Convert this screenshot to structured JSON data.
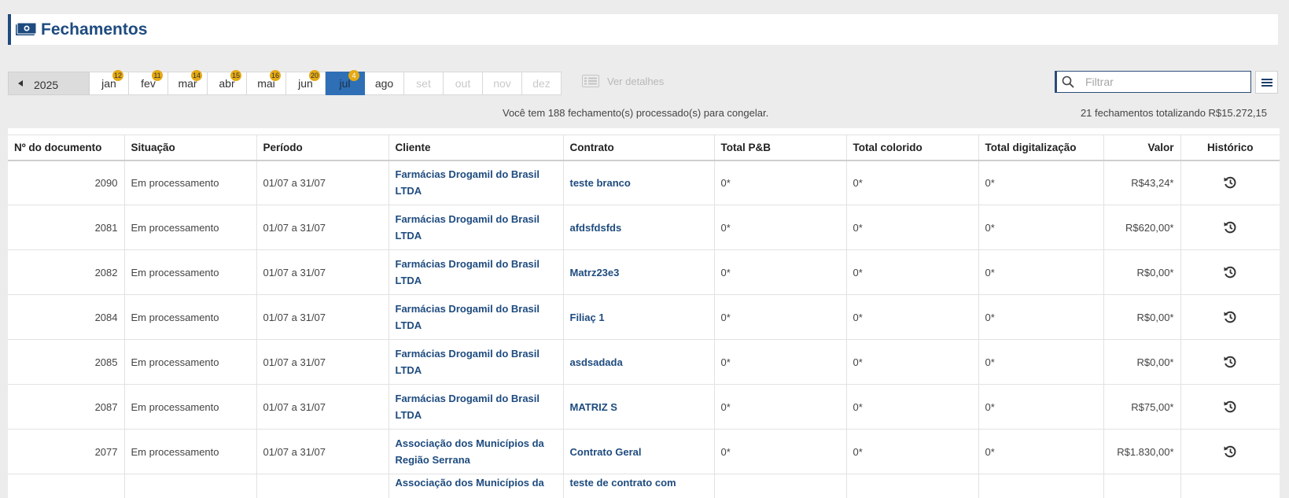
{
  "header": {
    "title": "Fechamentos",
    "icon": "money-icon",
    "accent": "#1e4b7f"
  },
  "calendar": {
    "year": "2025",
    "months": [
      {
        "label": "jan",
        "badge": "12",
        "state": "normal"
      },
      {
        "label": "fev",
        "badge": "11",
        "state": "normal"
      },
      {
        "label": "mar",
        "badge": "14",
        "state": "normal"
      },
      {
        "label": "abr",
        "badge": "15",
        "state": "normal"
      },
      {
        "label": "mai",
        "badge": "16",
        "state": "normal"
      },
      {
        "label": "jun",
        "badge": "20",
        "state": "normal"
      },
      {
        "label": "jul",
        "badge": "4",
        "state": "active"
      },
      {
        "label": "ago",
        "badge": "",
        "state": "normal"
      },
      {
        "label": "set",
        "badge": "",
        "state": "disabled"
      },
      {
        "label": "out",
        "badge": "",
        "state": "disabled"
      },
      {
        "label": "nov",
        "badge": "",
        "state": "disabled"
      },
      {
        "label": "dez",
        "badge": "",
        "state": "disabled"
      }
    ]
  },
  "toolbar": {
    "details_label": "Ver detalhes",
    "filter_placeholder": "Filtrar"
  },
  "info": {
    "processed_message": "Você tem 188 fechamento(s) processado(s) para congelar.",
    "total_message": "21 fechamentos totalizando R$15.272,15"
  },
  "table": {
    "headers": [
      "Nº do documento",
      "Situação",
      "Período",
      "Cliente",
      "Contrato",
      "Total P&B",
      "Total colorido",
      "Total digitalização",
      "Valor",
      "Histórico"
    ],
    "rows": [
      [
        "2090",
        "Em processamento",
        "01/07 a 31/07",
        "Farmácias Drogamil do Brasil LTDA",
        "teste branco",
        "0*",
        "0*",
        "0*",
        "R$43,24*"
      ],
      [
        "2081",
        "Em processamento",
        "01/07 a 31/07",
        "Farmácias Drogamil do Brasil LTDA",
        "afdsfdsfds",
        "0*",
        "0*",
        "0*",
        "R$620,00*"
      ],
      [
        "2082",
        "Em processamento",
        "01/07 a 31/07",
        "Farmácias Drogamil do Brasil LTDA",
        "Matrz23e3",
        "0*",
        "0*",
        "0*",
        "R$0,00*"
      ],
      [
        "2084",
        "Em processamento",
        "01/07 a 31/07",
        "Farmácias Drogamil do Brasil LTDA",
        "Filiaç 1",
        "0*",
        "0*",
        "0*",
        "R$0,00*"
      ],
      [
        "2085",
        "Em processamento",
        "01/07 a 31/07",
        "Farmácias Drogamil do Brasil LTDA",
        "asdsadada",
        "0*",
        "0*",
        "0*",
        "R$0,00*"
      ],
      [
        "2087",
        "Em processamento",
        "01/07 a 31/07",
        "Farmácias Drogamil do Brasil LTDA",
        "MATRIZ S",
        "0*",
        "0*",
        "0*",
        "R$75,00*"
      ],
      [
        "2077",
        "Em processamento",
        "01/07 a 31/07",
        "Associação dos Municípios da Região Serrana",
        "Contrato Geral",
        "0*",
        "0*",
        "0*",
        "R$1.830,00*"
      ],
      [
        "",
        "",
        "",
        "Associação dos Municípios da",
        "teste de contrato com",
        "",
        "",
        "",
        ""
      ]
    ]
  }
}
